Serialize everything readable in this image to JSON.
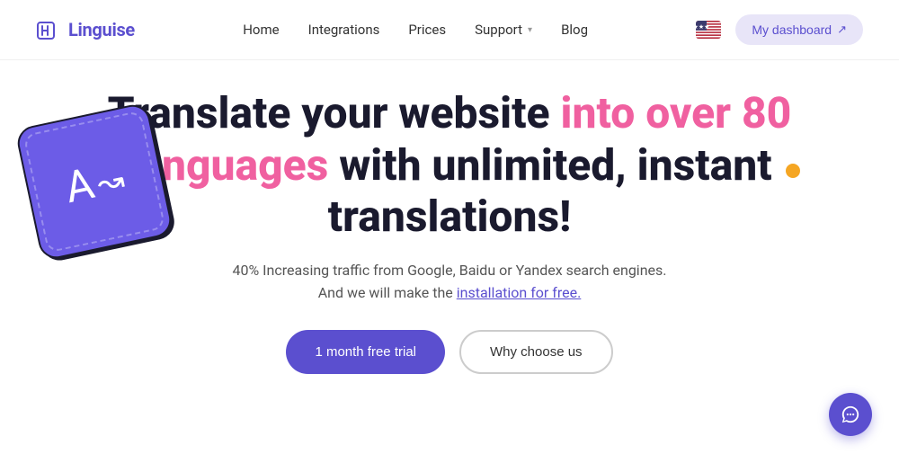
{
  "navbar": {
    "logo_text": "Linguise",
    "links": [
      {
        "label": "Home",
        "id": "home"
      },
      {
        "label": "Integrations",
        "id": "integrations"
      },
      {
        "label": "Prices",
        "id": "prices"
      },
      {
        "label": "Support",
        "id": "support",
        "has_dropdown": true
      },
      {
        "label": "Blog",
        "id": "blog"
      }
    ],
    "dashboard_button": "My dashboard",
    "external_icon": "↗"
  },
  "hero": {
    "title_part1": "Translate your website ",
    "title_highlight": "into over 80 languages",
    "title_part2": " with unlimited, instant translations!",
    "subtitle_line1": "40% Increasing traffic from Google, Baidu or Yandex search engines.",
    "subtitle_line2": "And we will make the ",
    "subtitle_link": "installation for free.",
    "subtitle_link_end": "",
    "btn_trial": "1 month free trial",
    "btn_why": "Why choose us"
  },
  "colors": {
    "brand": "#5b4fcf",
    "highlight": "#f060a0",
    "orange": "#f5a623",
    "text_dark": "#1a1a2e",
    "text_muted": "#555555"
  }
}
